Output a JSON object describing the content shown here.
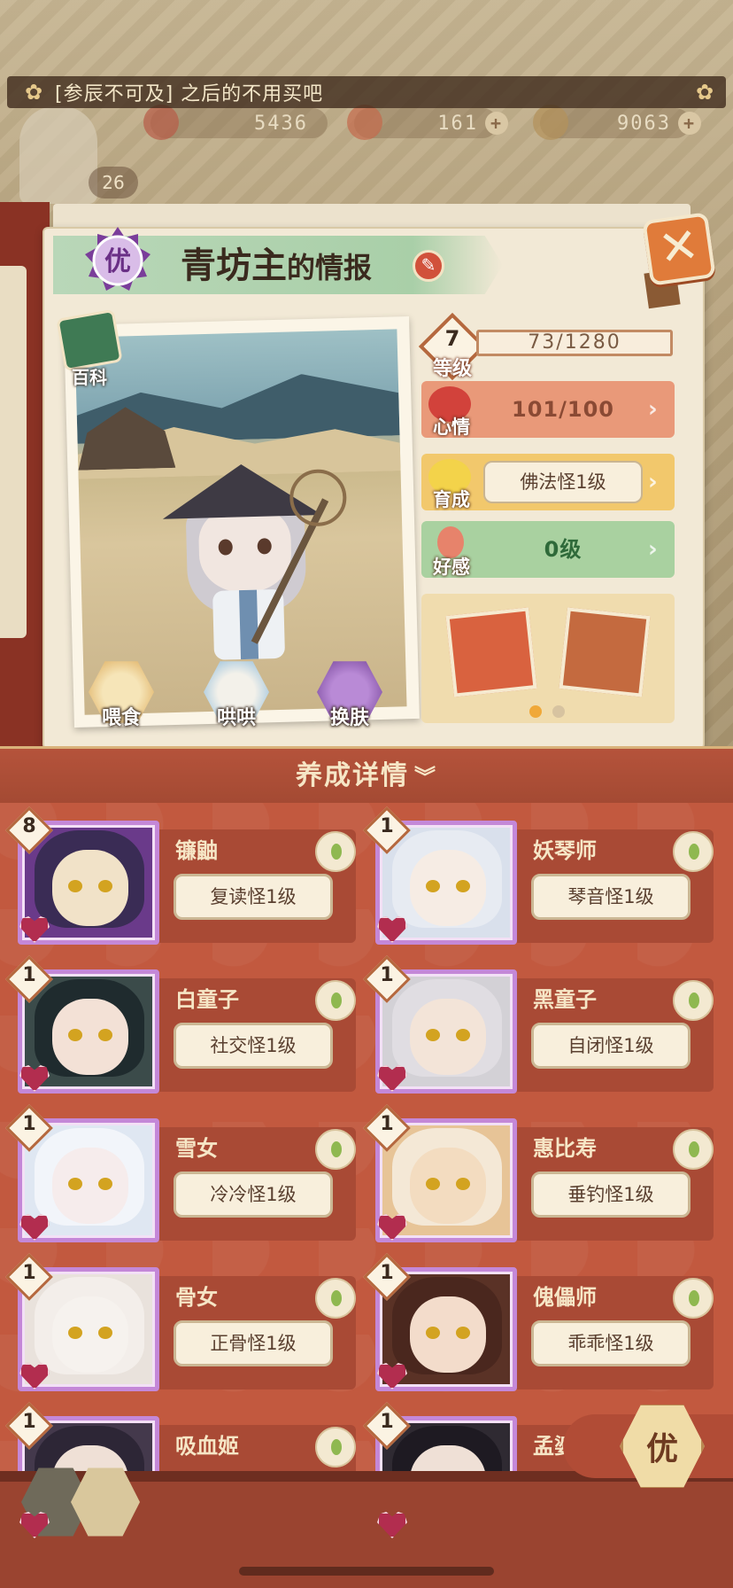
{
  "announcement": "[参辰不可及] 之后的不用买吧",
  "resources": [
    {
      "icon": "flower-coin-icon",
      "value": "5436"
    },
    {
      "icon": "magatama-icon",
      "value": "161"
    },
    {
      "icon": "gold-coin-icon",
      "value": "9063"
    }
  ],
  "player": {
    "level": "26"
  },
  "profile": {
    "rank": "优",
    "name": "青坊主",
    "title_suffix": "的情报",
    "encyclopedia_label": "百科",
    "level_label": "等级",
    "level": "7",
    "exp": "73/1280",
    "stats": [
      {
        "label": "心情",
        "value": "101/100",
        "color": "#e99979"
      },
      {
        "label": "育成",
        "value": "佛法怪1级",
        "color": "#f2c86c"
      },
      {
        "label": "好感",
        "value": "0级",
        "color": "#a9d1a0"
      }
    ],
    "actions": [
      {
        "label": "喂食",
        "icon": "noodle-bowl-icon"
      },
      {
        "label": "哄哄",
        "icon": "milk-carton-icon"
      },
      {
        "label": "换肤",
        "icon": "kimono-icon"
      }
    ]
  },
  "details_header": "养成详情",
  "shikigami": [
    {
      "name": "镰鼬",
      "level": "8",
      "trait": "复读怪1级"
    },
    {
      "name": "妖琴师",
      "level": "1",
      "trait": "琴音怪1级"
    },
    {
      "name": "白童子",
      "level": "1",
      "trait": "社交怪1级"
    },
    {
      "name": "黑童子",
      "level": "1",
      "trait": "自闭怪1级"
    },
    {
      "name": "雪女",
      "level": "1",
      "trait": "冷冷怪1级"
    },
    {
      "name": "惠比寿",
      "level": "1",
      "trait": "垂钓怪1级"
    },
    {
      "name": "骨女",
      "level": "1",
      "trait": "正骨怪1级"
    },
    {
      "name": "傀儡师",
      "level": "1",
      "trait": "乖乖怪1级"
    },
    {
      "name": "吸血姬",
      "level": "1",
      "trait": ""
    },
    {
      "name": "孟婆",
      "level": "1",
      "trait": ""
    }
  ],
  "rank_button": "优"
}
